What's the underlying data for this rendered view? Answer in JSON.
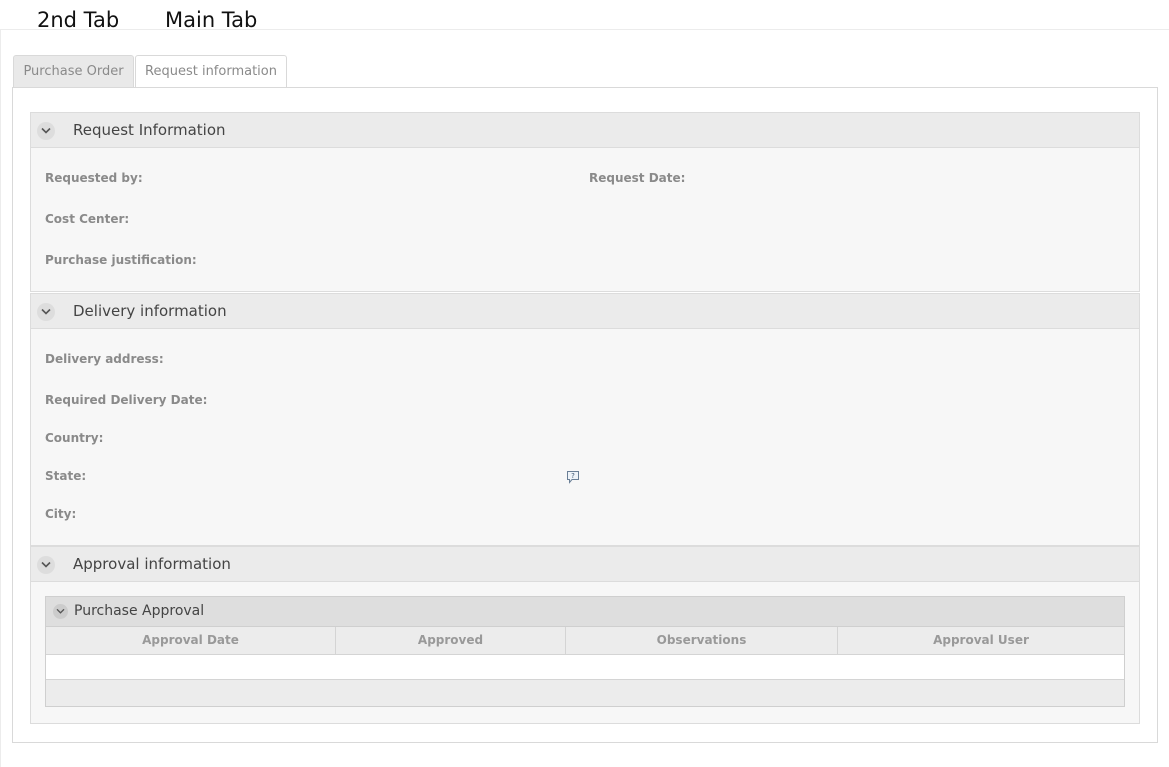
{
  "annotations": [
    {
      "text": "2nd Tab"
    },
    {
      "text": "Main Tab"
    }
  ],
  "tabs": [
    {
      "label": "Purchase Order",
      "active": false
    },
    {
      "label": "Request information",
      "active": true
    }
  ],
  "sections": {
    "request": {
      "title": "Request Information",
      "fields": {
        "requested_by": "Requested by:",
        "request_date": "Request Date:",
        "cost_center": "Cost Center:",
        "justification": "Purchase justification:"
      }
    },
    "delivery": {
      "title": "Delivery information",
      "fields": {
        "address": "Delivery address:",
        "required_date": "Required Delivery Date:",
        "country": "Country:",
        "state": "State:",
        "city": "City:"
      }
    },
    "approval": {
      "title": "Approval information",
      "grid": {
        "title": "Purchase Approval",
        "columns": [
          "Approval Date",
          "Approved",
          "Observations",
          "Approval User"
        ],
        "rows": []
      }
    }
  },
  "icons": {
    "collapse": "chevron-down-icon",
    "help": "help-comment-icon"
  }
}
